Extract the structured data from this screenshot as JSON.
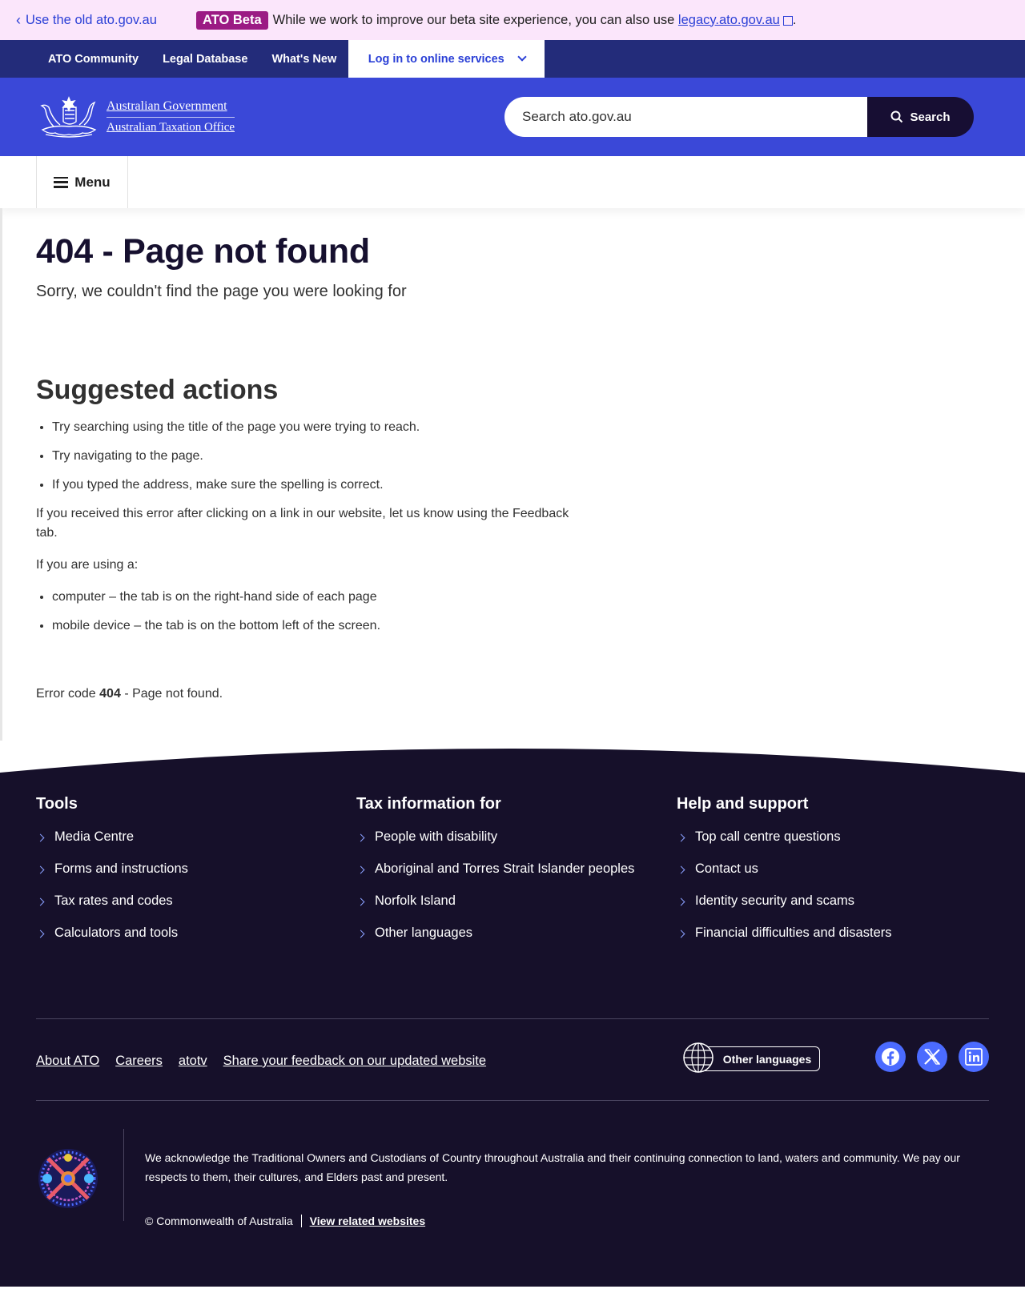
{
  "beta_banner": {
    "old_link": "Use the old ato.gov.au",
    "tag": "ATO Beta",
    "message": "While we work to improve our beta site experience, you can also use",
    "legacy_link": "legacy.ato.gov.au",
    "period": "."
  },
  "top_nav": {
    "items": [
      "ATO Community",
      "Legal Database",
      "What's New"
    ],
    "login": "Log in to online services"
  },
  "header": {
    "logo_line1": "Australian Government",
    "logo_line2": "Australian Taxation Office",
    "search_placeholder": "Search ato.gov.au",
    "search_button": "Search"
  },
  "menu": {
    "label": "Menu"
  },
  "main": {
    "title": "404 - Page not found",
    "subtitle": "Sorry, we couldn't find the page you were looking for",
    "suggested_heading": "Suggested actions",
    "suggestions": [
      "Try searching using the title of the page you were trying to reach.",
      "Try navigating to the page.",
      "If you typed the address, make sure the spelling is correct."
    ],
    "feedback_para": "If you received this error after clicking on a link in our website, let us know using the Feedback tab.",
    "using_para": "If you are using a:",
    "devices": [
      "computer – the tab is on the right-hand side of each page",
      "mobile device – the tab is on the bottom left of the screen."
    ],
    "error_prefix": "Error code",
    "error_code": "404",
    "error_suffix": "- Page not found."
  },
  "footer": {
    "columns": [
      {
        "heading": "Tools",
        "items": [
          "Media Centre",
          "Forms and instructions",
          "Tax rates and codes",
          "Calculators and tools"
        ]
      },
      {
        "heading": "Tax information for",
        "items": [
          "People with disability",
          "Aboriginal and Torres Strait Islander peoples",
          "Norfolk Island",
          "Other languages"
        ]
      },
      {
        "heading": "Help and support",
        "items": [
          "Top call centre questions",
          "Contact us",
          "Identity security and scams",
          "Financial difficulties and disasters"
        ]
      }
    ],
    "links": [
      "About ATO",
      "Careers",
      "atotv",
      "Share your feedback on our updated website"
    ],
    "languages_button": "Other languages",
    "social": [
      "facebook-icon",
      "x-icon",
      "linkedin-icon"
    ],
    "acknowledgement": "We acknowledge the Traditional Owners and Custodians of Country throughout Australia and their continuing connection to land, waters and community. We pay our respects to them, their cultures, and Elders past and present.",
    "copyright": "© Commonwealth of Australia",
    "related_link": "View related websites"
  },
  "colors": {
    "banner_bg": "#fbe6fb",
    "nav_bg": "#232c7a",
    "header_bg": "#3a48d8",
    "footer_bg": "#16102a",
    "accent": "#2a3fd6"
  }
}
